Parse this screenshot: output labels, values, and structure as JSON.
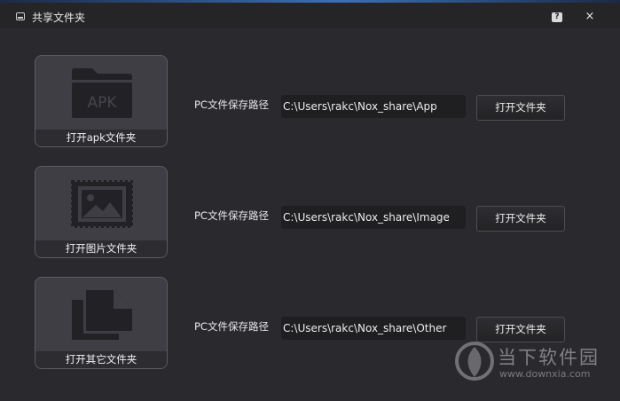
{
  "window": {
    "title": "共享文件夹",
    "help_label": "?",
    "close_label": "×"
  },
  "rows": [
    {
      "tile_label": "打开apk文件夹",
      "tile_icon": "apk-folder-icon",
      "apk_text": "APK",
      "path_label": "PC文件保存路径",
      "path_value": "C:\\Users\\rakc\\Nox_share\\App",
      "button_label": "打开文件夹"
    },
    {
      "tile_label": "打开图片文件夹",
      "tile_icon": "image-icon",
      "path_label": "PC文件保存路径",
      "path_value": "C:\\Users\\rakc\\Nox_share\\Image",
      "button_label": "打开文件夹"
    },
    {
      "tile_label": "打开其它文件夹",
      "tile_icon": "documents-icon",
      "path_label": "PC文件保存路径",
      "path_value": "C:\\Users\\rakc\\Nox_share\\Other",
      "button_label": "打开文件夹"
    }
  ],
  "watermark": {
    "name": "当下软件园",
    "url": "www.downxia.com"
  }
}
